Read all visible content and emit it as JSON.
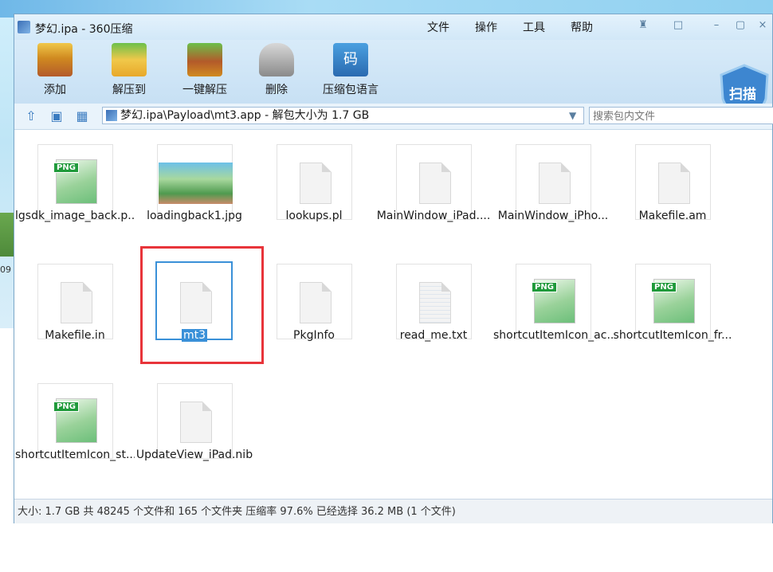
{
  "window": {
    "title": "梦幻.ipa - 360压缩"
  },
  "menu": [
    "文件",
    "操作",
    "工具",
    "帮助"
  ],
  "toolbar": {
    "add": "添加",
    "extract_to": "解压到",
    "one_click": "一键解压",
    "delete": "删除",
    "lang": "压缩包语言",
    "scan": "扫描"
  },
  "address": {
    "path": "梦幻.ipa\\Payload\\mt3.app - 解包大小为 1.7 GB",
    "search_placeholder": "搜索包内文件"
  },
  "files": [
    {
      "name": "lgsdk_image_back.p...",
      "icon": "png"
    },
    {
      "name": "loadingback1.jpg",
      "icon": "photo"
    },
    {
      "name": "lookups.pl",
      "icon": "doc"
    },
    {
      "name": "MainWindow_iPad....",
      "icon": "doc"
    },
    {
      "name": "MainWindow_iPho...",
      "icon": "doc"
    },
    {
      "name": "Makefile.am",
      "icon": "doc"
    },
    {
      "name": "Makefile.in",
      "icon": "doc"
    },
    {
      "name": "mt3",
      "icon": "doc"
    },
    {
      "name": "PkgInfo",
      "icon": "doc"
    },
    {
      "name": "read_me.txt",
      "icon": "doc"
    },
    {
      "name": "shortcutItemIcon_ac...",
      "icon": "png"
    },
    {
      "name": "shortcutItemIcon_fr...",
      "icon": "png"
    },
    {
      "name": "shortcutItemIcon_st...",
      "icon": "png"
    },
    {
      "name": "UpdateView_iPad.nib",
      "icon": "doc"
    }
  ],
  "status": "大小: 1.7 GB 共 48245 个文件和 165 个文件夹 压缩率 97.6% 已经选择 36.2 MB (1 个文件)",
  "desktop_text": "09",
  "colors": {
    "selection": "#3a90d8",
    "highlight_box": "#e8343a",
    "png_tag": "#1f9a3a"
  }
}
